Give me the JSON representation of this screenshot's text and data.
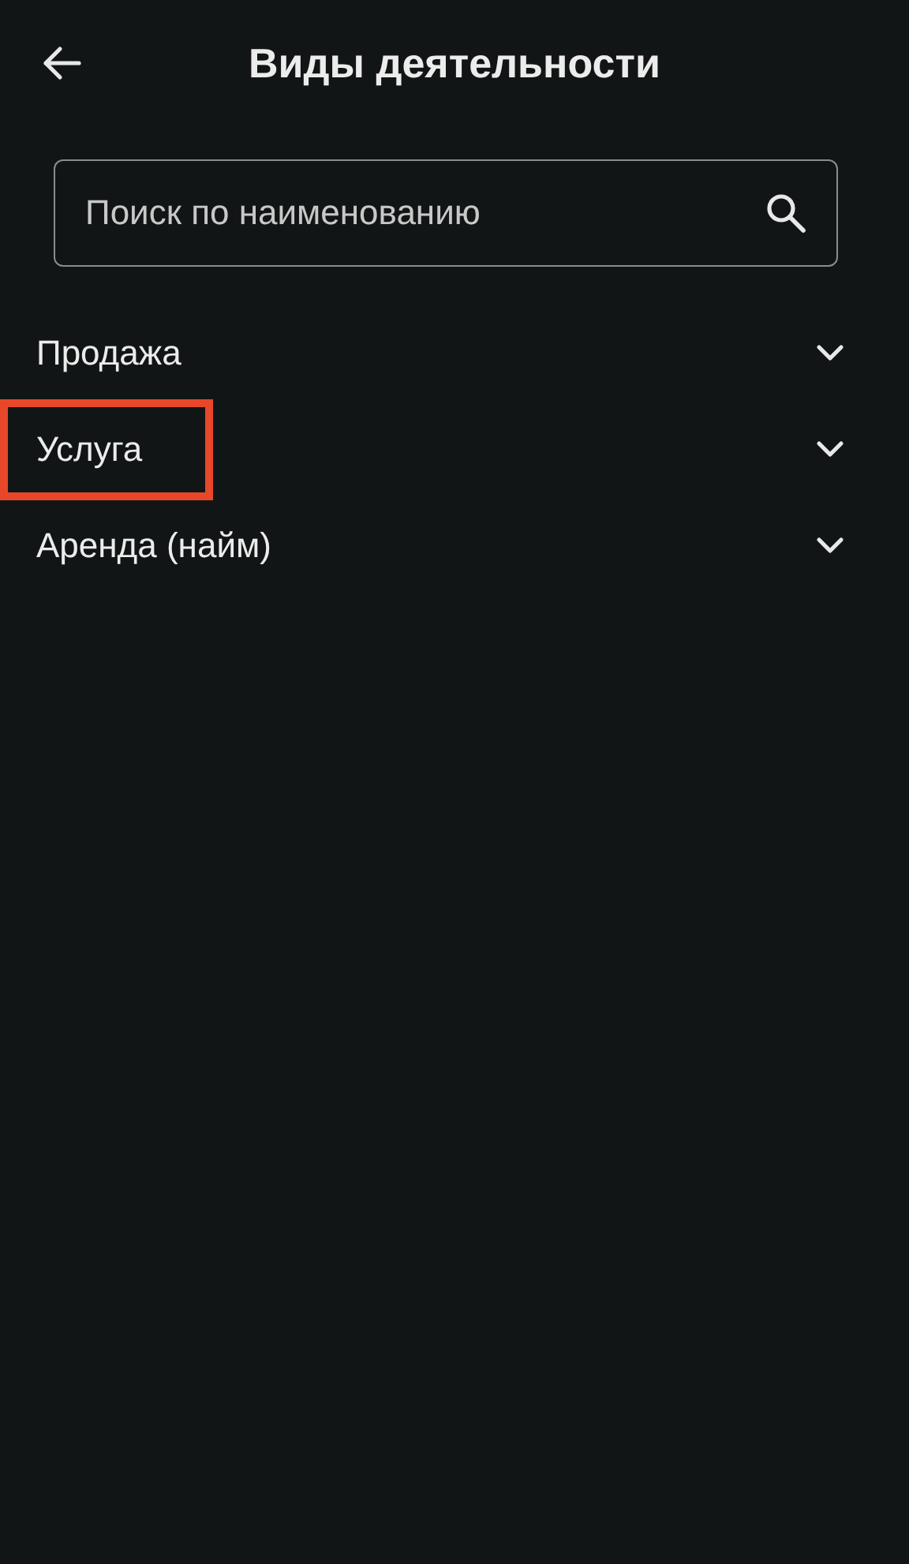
{
  "header": {
    "title": "Виды деятельности"
  },
  "search": {
    "placeholder": "Поиск по наименованию"
  },
  "items": [
    {
      "label": "Продажа",
      "expanded": false,
      "highlighted": false
    },
    {
      "label": "Услуга",
      "expanded": false,
      "highlighted": true
    },
    {
      "label": "Аренда (найм)",
      "expanded": false,
      "highlighted": false
    }
  ]
}
